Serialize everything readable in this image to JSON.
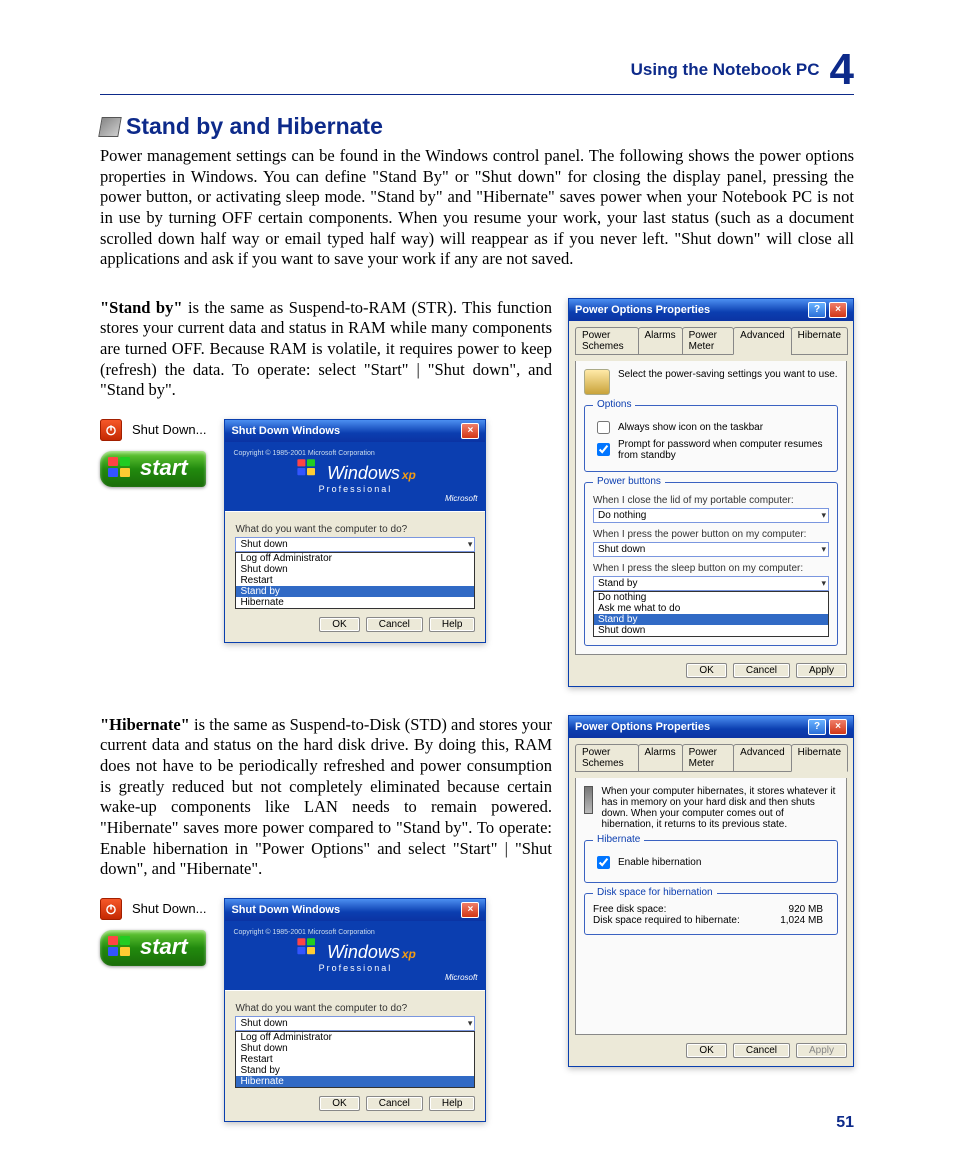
{
  "header": {
    "title": "Using the Notebook PC",
    "chapter": "4"
  },
  "page_number": "51",
  "section": {
    "title": "Stand by and Hibernate",
    "intro": "Power management settings can be found in the Windows control panel. The following shows the power options properties in Windows. You can define \"Stand By\" or \"Shut down\" for closing the display panel, pressing the power button, or activating sleep mode. \"Stand by\" and \"Hibernate\" saves power when your Notebook PC is not in use by turning OFF certain components. When you resume your work, your last status (such as a document scrolled down half way or email typed half way) will reappear as if you never left. \"Shut down\" will close all applications and ask if you want to save your work if any are not saved."
  },
  "standby": {
    "lead": "\"Stand by\"",
    "text": " is the same as Suspend-to-RAM (STR). This function stores your current data and status in RAM while many components are turned OFF. Because RAM is volatile, it requires power to keep (refresh) the data. To operate: select \"Start\" | \"Shut down\", and \"Stand by\"."
  },
  "hibernate": {
    "lead": "\"Hibernate\"",
    "text": " is the same as  Suspend-to-Disk (STD) and stores your current data and status on the hard disk drive. By doing this, RAM does not have to be periodically refreshed and power consumption is greatly reduced but not completely eliminated because certain wake-up components like LAN needs to remain powered. \"Hibernate\" saves more power compared to \"Stand by\". To operate: Enable hibernation in \"Power Options\" and select \"Start\" | \"Shut down\", and \"Hibernate\"."
  },
  "os_ui": {
    "shutdown_label": "Shut Down...",
    "start_label": "start",
    "sdw": {
      "title": "Shut Down Windows",
      "brand": "Windows",
      "edition": "Professional",
      "copyright": "Copyright © 1985-2001 Microsoft Corporation",
      "ms": "Microsoft",
      "prompt": "What do you want the computer to do?",
      "value": "Shut down",
      "options": [
        "Log off Administrator",
        "Shut down",
        "Restart",
        "Stand by",
        "Hibernate"
      ],
      "highlight_standby": "Stand by",
      "highlight_hibernate": "Hibernate",
      "ok": "OK",
      "cancel": "Cancel",
      "help": "Help"
    },
    "power_adv": {
      "title": "Power Options Properties",
      "tabs": [
        "Power Schemes",
        "Alarms",
        "Power Meter",
        "Advanced",
        "Hibernate"
      ],
      "desc": "Select the power-saving settings you want to use.",
      "options_legend": "Options",
      "cb1": "Always show icon on the taskbar",
      "cb2": "Prompt for password when computer resumes from standby",
      "pb_legend": "Power buttons",
      "q1": "When I close the lid of my portable computer:",
      "a1": "Do nothing",
      "q2": "When I press the power button on my computer:",
      "a2": "Shut down",
      "q3": "When I press the sleep button on my computer:",
      "a3": "Stand by",
      "dropdown": [
        "Do nothing",
        "Ask me what to do",
        "Stand by",
        "Shut down"
      ],
      "ok": "OK",
      "cancel": "Cancel",
      "apply": "Apply"
    },
    "power_hib": {
      "title": "Power Options Properties",
      "tabs": [
        "Power Schemes",
        "Alarms",
        "Power Meter",
        "Advanced",
        "Hibernate"
      ],
      "desc": "When your computer hibernates, it stores whatever it has in memory on your hard disk and then shuts down. When your computer comes out of hibernation, it returns to its previous state.",
      "hib_legend": "Hibernate",
      "enable": "Enable hibernation",
      "disk_legend": "Disk space for hibernation",
      "free_l": "Free disk space:",
      "free_v": "920 MB",
      "req_l": "Disk space required to hibernate:",
      "req_v": "1,024 MB",
      "ok": "OK",
      "cancel": "Cancel",
      "apply": "Apply"
    }
  }
}
